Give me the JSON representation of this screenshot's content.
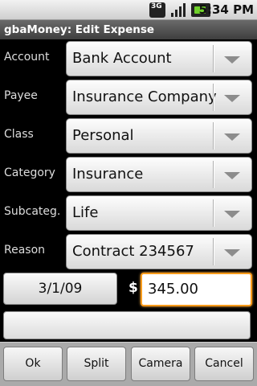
{
  "status_bar": {
    "network_label": "3G",
    "time": "5:34 PM",
    "icons": [
      "3g-data-icon",
      "signal-strength-icon",
      "battery-charging-icon"
    ]
  },
  "title": "gbaMoney: Edit Expense",
  "fields": [
    {
      "label": "Account",
      "value": "Bank Account"
    },
    {
      "label": "Payee",
      "value": "Insurance Company"
    },
    {
      "label": "Class",
      "value": "Personal"
    },
    {
      "label": "Category",
      "value": "Insurance"
    },
    {
      "label": "Subcateg.",
      "value": "Life"
    },
    {
      "label": "Reason",
      "value": "Contract 234567"
    }
  ],
  "date": "3/1/09",
  "currency_symbol": "$",
  "amount": "345.00",
  "memo": "",
  "buttons": {
    "ok": "Ok",
    "split": "Split",
    "camera": "Camera",
    "cancel": "Cancel"
  },
  "colors": {
    "focus_border": "#ff9b1a",
    "title_bar": "#4e4e4e",
    "background": "#000000"
  }
}
